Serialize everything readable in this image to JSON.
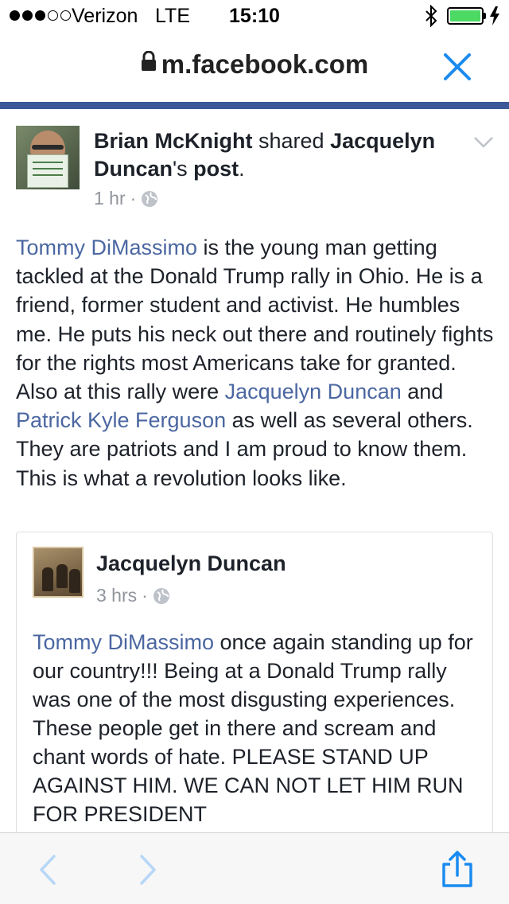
{
  "status_bar": {
    "carrier": "Verizon",
    "network": "LTE",
    "time": "15:10",
    "signal_bars_full": 3,
    "signal_bars_total": 5,
    "battery_level": 1.0,
    "battery_color": "#4cd964"
  },
  "browser": {
    "url": "m.facebook.com",
    "accent_color": "#3b5998",
    "icons": [
      "lock-icon",
      "close-icon",
      "back-icon",
      "forward-icon",
      "share-icon"
    ]
  },
  "post": {
    "author": "Brian McKnight",
    "action": " shared ",
    "original_author": "Jacquelyn Duncan",
    "post_suffix_possessive": "'s ",
    "post_word": "post",
    "period": ".",
    "time": "1 hr",
    "dot": "·",
    "body": {
      "link1": "Tommy DiMassimo",
      "text1": " is the young man getting tackled at the Donald Trump rally in Ohio. He is a friend, former student and activist. He humbles me. He puts his neck out there and routinely fights for the rights most Americans take for granted. Also at this rally were ",
      "link2": "Jacquelyn Duncan",
      "text2": " and ",
      "link3": "Patrick Kyle Ferguson",
      "text3": " as well as several others. They are patriots and I am proud to know them. This is what a revolution looks like."
    }
  },
  "shared_post": {
    "author": "Jacquelyn Duncan",
    "time": "3 hrs",
    "dot": "·",
    "body": {
      "link1": "Tommy DiMassimo",
      "text1": " once again standing up for our country!!! Being at a Donald Trump rally was one of the most disgusting experiences. These people get in there and scream and chant words of hate. PLEASE STAND UP AGAINST HIM. WE CAN NOT LET HIM RUN FOR PRESIDENT"
    }
  },
  "colors": {
    "link": "#4b67a1",
    "text": "#1d2129",
    "meta": "#90949c",
    "ios_blue": "#1a8bf0"
  }
}
